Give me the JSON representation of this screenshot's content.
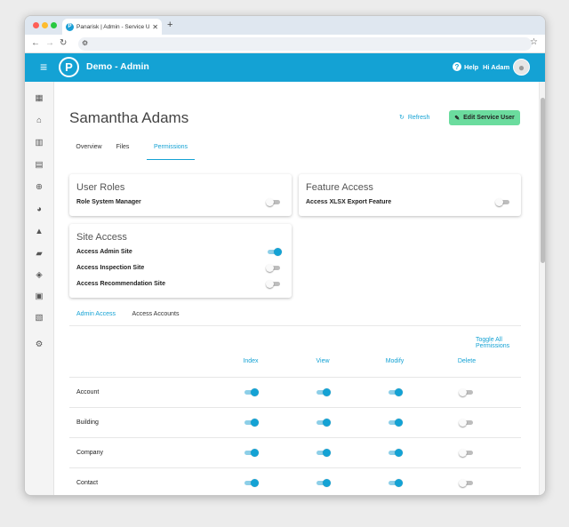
{
  "browser": {
    "tab_title": "Panarisk | Admin - Service User",
    "tab_favicon": "P",
    "close_glyph": "✕",
    "new_tab_glyph": "+"
  },
  "app": {
    "logo_letter": "P",
    "title": "Demo - Admin",
    "help_label": "Help",
    "greeting": "Hi Adam",
    "accent_color": "#14a2d4",
    "success_color": "#6bdc9e"
  },
  "sidebar": {
    "icons": [
      "dashboard-icon",
      "bank-icon",
      "building-icon",
      "map-icon",
      "search-zoom-icon",
      "pie-icon",
      "warning-icon",
      "file-icon",
      "shield-icon",
      "badge-icon",
      "bus-icon",
      "settings-icon"
    ]
  },
  "page": {
    "title": "Samantha Adams",
    "refresh_label": "Refresh",
    "edit_label": "Edit Service User",
    "tabs": [
      {
        "label": "Overview",
        "active": false
      },
      {
        "label": "Files",
        "active": false
      },
      {
        "label": "Permissions",
        "active": true
      }
    ]
  },
  "user_roles": {
    "title": "User Roles",
    "items": [
      {
        "label": "Role System Manager",
        "on": false
      }
    ]
  },
  "feature_access": {
    "title": "Feature Access",
    "items": [
      {
        "label": "Access XLSX Export Feature",
        "on": false
      }
    ]
  },
  "site_access": {
    "title": "Site Access",
    "items": [
      {
        "label": "Access Admin Site",
        "on": true
      },
      {
        "label": "Access Inspection Site",
        "on": false
      },
      {
        "label": "Access Recommendation Site",
        "on": false
      }
    ]
  },
  "permissions": {
    "subtabs": [
      {
        "label": "Admin Access",
        "active": true
      },
      {
        "label": "Access Accounts",
        "active": false
      }
    ],
    "toggle_all_label": "Toggle All Permissions",
    "columns": [
      "Index",
      "View",
      "Modify",
      "Delete"
    ],
    "rows": [
      {
        "name": "Account",
        "values": [
          true,
          true,
          true,
          false
        ]
      },
      {
        "name": "Building",
        "values": [
          true,
          true,
          true,
          false
        ]
      },
      {
        "name": "Company",
        "values": [
          true,
          true,
          true,
          false
        ]
      },
      {
        "name": "Contact",
        "values": [
          true,
          true,
          true,
          false
        ]
      },
      {
        "name": "",
        "values": [
          true,
          true,
          true,
          false
        ]
      }
    ]
  }
}
